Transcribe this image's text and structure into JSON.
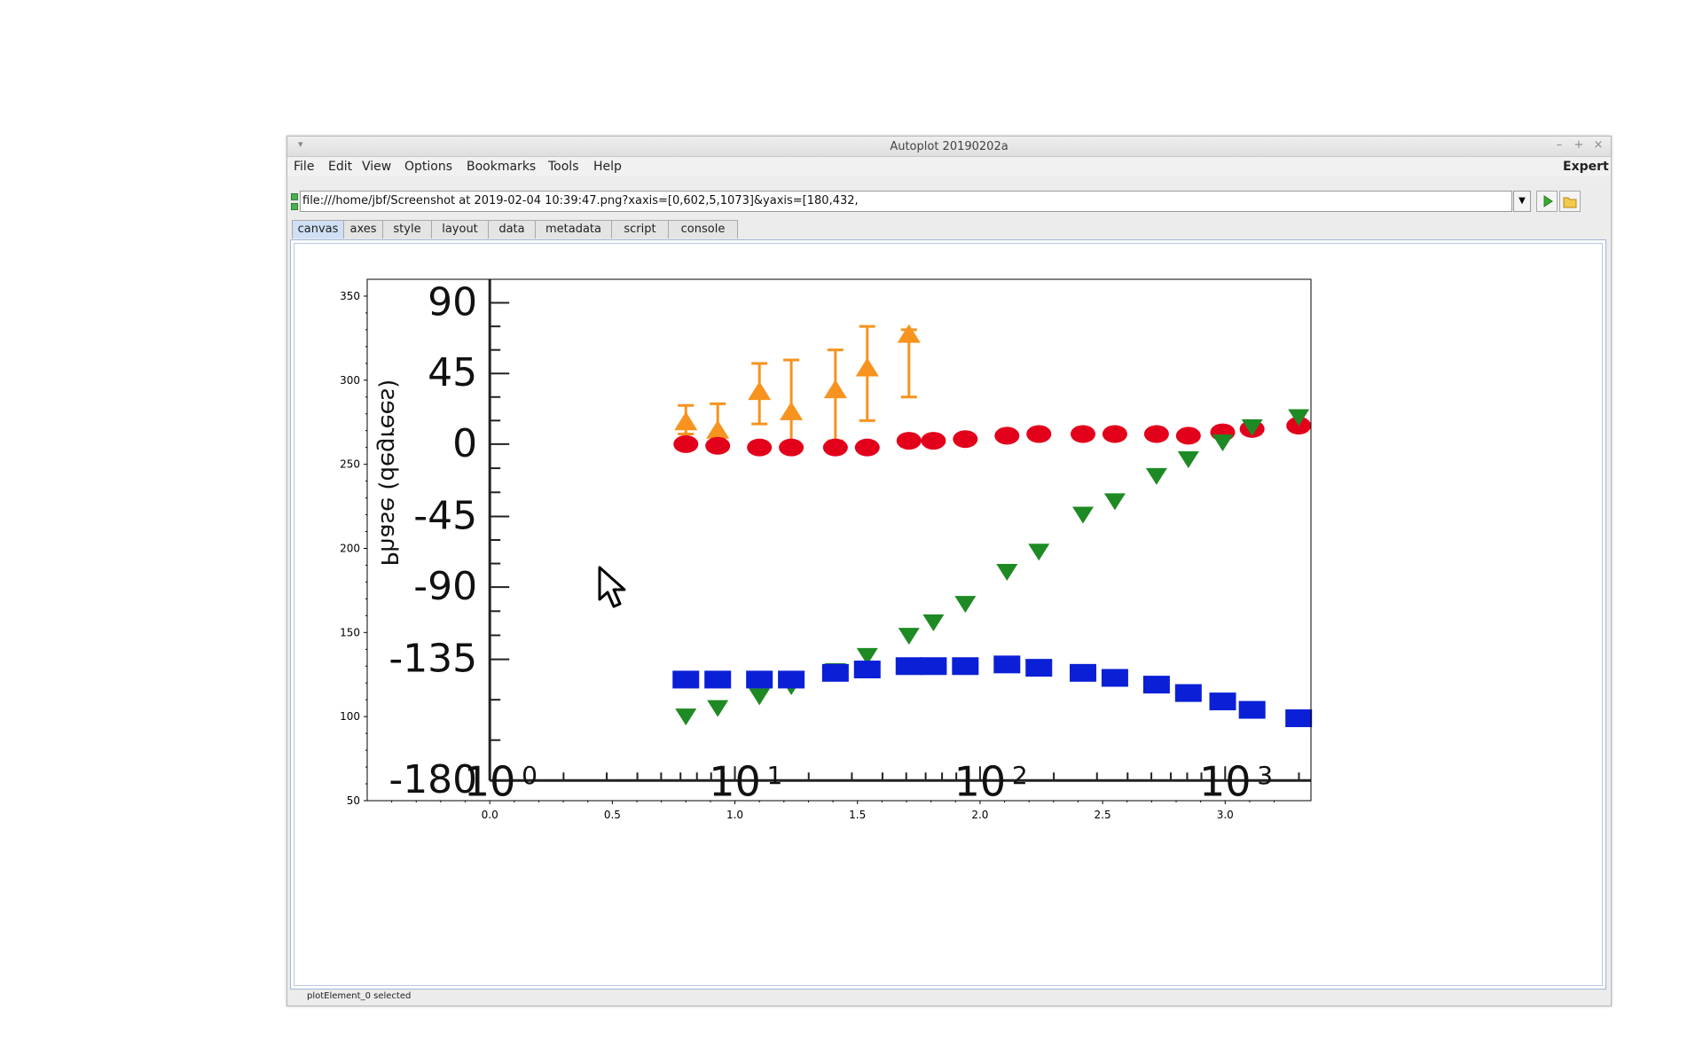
{
  "window": {
    "title": "Autoplot 20190202a"
  },
  "menubar": {
    "items": [
      "File",
      "Edit",
      "View",
      "Options",
      "Bookmarks",
      "Tools",
      "Help"
    ],
    "expert_label": "Expert"
  },
  "url": {
    "value": "file:///home/jbf/Screenshot at 2019-02-04 10:39:47.png?xaxis=[0,602,5,1073]&yaxis=[180,432,"
  },
  "tabs": [
    "canvas",
    "axes",
    "style",
    "layout",
    "data",
    "metadata",
    "script",
    "console"
  ],
  "active_tab": "canvas",
  "status": {
    "text": "plotElement_0 selected"
  },
  "chart_data": {
    "type": "scatter",
    "xlim": [
      -0.5,
      3.35
    ],
    "ylim": [
      50,
      360
    ],
    "x_ticks": [
      0.0,
      0.5,
      1.0,
      1.5,
      2.0,
      2.5,
      3.0
    ],
    "x_tick_labels": [
      "0.0",
      "0.5",
      "1.0",
      "1.5",
      "2.0",
      "2.5",
      "3.0"
    ],
    "y_ticks": [
      50,
      100,
      150,
      200,
      250,
      300,
      350
    ],
    "y_tick_labels": [
      "50",
      "100",
      "150",
      "200",
      "250",
      "300",
      "350"
    ],
    "embedded_image": {
      "y_tick_labels": [
        "90",
        "45",
        "0",
        "-45",
        "-90",
        "-135",
        "-180"
      ],
      "y_label": "Phase (degrees)",
      "x_tick_labels": [
        "10",
        "10",
        "10",
        "10"
      ],
      "x_tick_exponents": [
        "0",
        "1",
        "2",
        "3"
      ],
      "colors": {
        "orange": "#f7931e",
        "red": "#e3001b",
        "green": "#1e8a23",
        "blue": "#0a1fd6"
      }
    },
    "series": [
      {
        "values": [
          [
            0.8,
            275
          ],
          [
            0.93,
            270
          ],
          [
            1.1,
            293
          ],
          [
            1.23,
            281
          ],
          [
            1.41,
            294
          ],
          [
            1.54,
            307
          ],
          [
            1.71,
            327
          ]
        ],
        "err_low": [
          268,
          258,
          274,
          258,
          264,
          276,
          290
        ],
        "err_high": [
          285,
          286,
          310,
          312,
          318,
          332,
          330
        ],
        "marker": "triangle-up",
        "color": "#f7931e"
      },
      {
        "values": [
          [
            0.8,
            262
          ],
          [
            0.93,
            261
          ],
          [
            1.1,
            260
          ],
          [
            1.23,
            260
          ],
          [
            1.41,
            260
          ],
          [
            1.54,
            260
          ],
          [
            1.71,
            264
          ],
          [
            1.81,
            264
          ],
          [
            1.94,
            265
          ],
          [
            2.11,
            267
          ],
          [
            2.24,
            268
          ],
          [
            2.42,
            268
          ],
          [
            2.55,
            268
          ],
          [
            2.72,
            268
          ],
          [
            2.85,
            267
          ],
          [
            2.99,
            269
          ],
          [
            3.11,
            271
          ],
          [
            3.3,
            273
          ]
        ],
        "marker": "circle",
        "color": "#e3001b"
      },
      {
        "values": [
          [
            0.8,
            100
          ],
          [
            0.93,
            105
          ],
          [
            1.1,
            112
          ],
          [
            1.23,
            118
          ],
          [
            1.41,
            127
          ],
          [
            1.54,
            136
          ],
          [
            1.71,
            148
          ],
          [
            1.81,
            156
          ],
          [
            1.94,
            167
          ],
          [
            2.11,
            186
          ],
          [
            2.24,
            198
          ],
          [
            2.42,
            220
          ],
          [
            2.55,
            228
          ],
          [
            2.72,
            243
          ],
          [
            2.85,
            253
          ],
          [
            2.99,
            263
          ],
          [
            3.11,
            272
          ],
          [
            3.3,
            278
          ]
        ],
        "marker": "triangle-down",
        "color": "#1e8a23"
      },
      {
        "values": [
          [
            0.8,
            122
          ],
          [
            0.93,
            122
          ],
          [
            1.1,
            122
          ],
          [
            1.23,
            122
          ],
          [
            1.41,
            126
          ],
          [
            1.54,
            128
          ],
          [
            1.71,
            130
          ],
          [
            1.81,
            130
          ],
          [
            1.94,
            130
          ],
          [
            2.11,
            131
          ],
          [
            2.24,
            129
          ],
          [
            2.42,
            126
          ],
          [
            2.55,
            123
          ],
          [
            2.72,
            119
          ],
          [
            2.85,
            114
          ],
          [
            2.99,
            109
          ],
          [
            3.11,
            104
          ],
          [
            3.3,
            99
          ]
        ],
        "marker": "square",
        "color": "#0a1fd6"
      }
    ]
  }
}
